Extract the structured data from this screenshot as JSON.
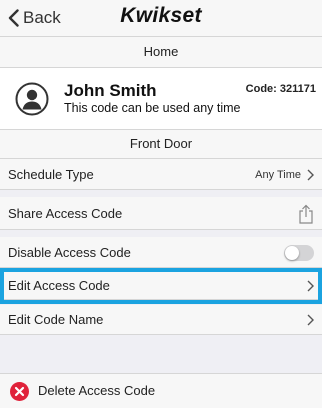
{
  "nav": {
    "back_label": "Back",
    "brand": "Kwikset"
  },
  "home": {
    "label": "Home"
  },
  "user": {
    "name": "John Smith",
    "description": "This code can be used any time",
    "code_label": "Code: 321171",
    "avatar_icon": "person-circle-icon"
  },
  "lock": {
    "name": "Front Door"
  },
  "settings": {
    "schedule_type": {
      "label": "Schedule Type",
      "value": "Any Time"
    },
    "share_access_code": {
      "label": "Share Access Code",
      "icon": "share-icon"
    },
    "disable_access_code": {
      "label": "Disable Access Code",
      "enabled": false
    },
    "edit_access_code": {
      "label": "Edit Access Code",
      "highlighted": true
    },
    "edit_code_name": {
      "label": "Edit Code Name"
    }
  },
  "delete": {
    "label": "Delete Access Code",
    "icon": "delete-x-icon"
  },
  "colors": {
    "highlight": "#1ba3e0",
    "delete": "#e0223a",
    "background": "#efeff4"
  }
}
